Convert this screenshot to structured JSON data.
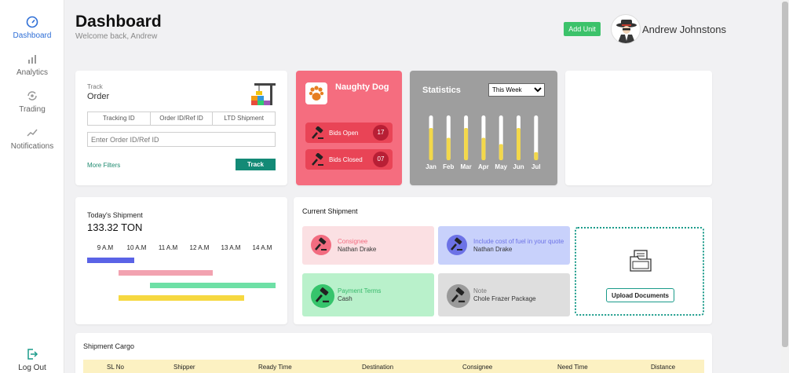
{
  "sidebar": {
    "items": [
      {
        "label": "Dashboard",
        "icon": "gauge-icon"
      },
      {
        "label": "Analytics",
        "icon": "bar-chart-icon"
      },
      {
        "label": "Trading",
        "icon": "refresh-icon"
      },
      {
        "label": "Notifications",
        "icon": "trend-icon"
      }
    ],
    "logout": {
      "label": "Log Out",
      "icon": "logout-icon"
    }
  },
  "header": {
    "title": "Dashboard",
    "subtitle": "Welcome back, Andrew",
    "add_unit_label": "Add Unit",
    "user_name": "Andrew Johnstons"
  },
  "track": {
    "label": "Track",
    "title": "Order",
    "tabs": [
      "Tracking ID",
      "Order ID/Ref ID",
      "LTD Shipment"
    ],
    "placeholder": "Enter Order ID/Ref ID",
    "more_filters": "More Filters",
    "button": "Track"
  },
  "company": {
    "name": "Naughty Dog",
    "bids_open_label": "Bids Open",
    "bids_open_count": "17",
    "bids_closed_label": "Bids Closed",
    "bids_closed_count": "07"
  },
  "statistics": {
    "title": "Statistics",
    "period_options": [
      "This Week"
    ],
    "selected_period": "This Week",
    "bar_color": "#f3d84a",
    "track_color": "#ffffff",
    "months": [
      {
        "label": "Jan",
        "fill": 0.72
      },
      {
        "label": "Feb",
        "fill": 0.5
      },
      {
        "label": "Mar",
        "fill": 0.72
      },
      {
        "label": "Apr",
        "fill": 0.5
      },
      {
        "label": "May",
        "fill": 0.36
      },
      {
        "label": "Jun",
        "fill": 0.72
      },
      {
        "label": "Jul",
        "fill": 0.18
      }
    ]
  },
  "today": {
    "title": "Today's Shipment",
    "total": "133.32 TON",
    "times": [
      "9 A.M",
      "10 A.M",
      "11 A.M",
      "12 A.M",
      "13 A.M",
      "14 A.M"
    ],
    "bars": [
      {
        "start": 0,
        "end": 1.5,
        "color": "#5a63e6"
      },
      {
        "start": 1,
        "end": 4,
        "color": "#f2a2b0"
      },
      {
        "start": 2,
        "end": 6,
        "color": "#6ee0a6"
      },
      {
        "start": 1,
        "end": 5,
        "color": "#f6d840"
      }
    ]
  },
  "current": {
    "title": "Current Shipment",
    "tiles": [
      {
        "title": "Consignee",
        "value": "Nathan Drake",
        "title_color": "#f26c80",
        "circle_color": "#f26c80"
      },
      {
        "title": "Include cost of fuel in your quote",
        "value": "Nathan Drake",
        "title_color": "#6c72e6",
        "circle_color": "#6c72e6"
      },
      {
        "title": "Payment Terms",
        "value": "Cash",
        "title_color": "#36b86a",
        "circle_color": "#36c46c"
      },
      {
        "title": "Note",
        "value": "Chole Frazer Package",
        "title_color": "#777777",
        "circle_color": "#9a9a9a"
      }
    ],
    "upload_label": "Upload Documents"
  },
  "cargo": {
    "title": "Shipment Cargo",
    "columns": [
      "SL No",
      "Shipper",
      "Ready Time",
      "Destination",
      "Consignee",
      "Need Time",
      "Distance"
    ]
  }
}
